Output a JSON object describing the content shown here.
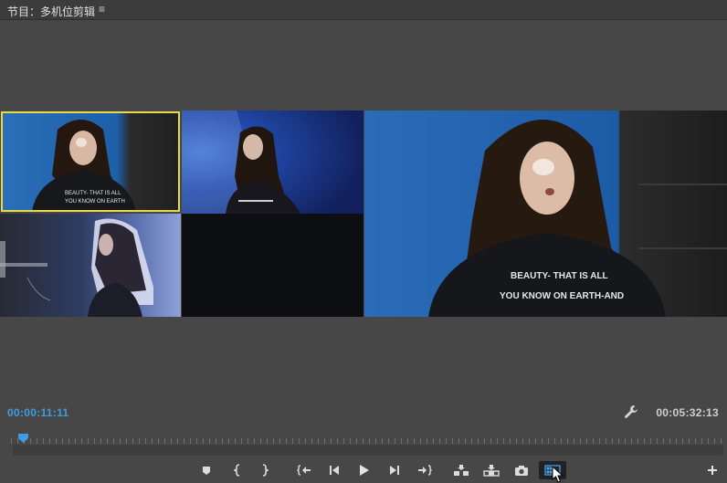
{
  "panel": {
    "title": "节目：多机位剪辑",
    "menu_glyph": "≡"
  },
  "multicam": {
    "cameras": [
      {
        "name": "camera-1",
        "active": true,
        "shirt_text": [
          "BEAUTY- THAT IS ALL",
          "YOU KNOW ON EARTH"
        ]
      },
      {
        "name": "camera-2",
        "active": false
      },
      {
        "name": "camera-3",
        "active": false
      },
      {
        "name": "camera-4",
        "active": false
      }
    ],
    "program_shirt_text": [
      "BEAUTY- THAT IS ALL",
      "YOU KNOW ON EARTH-AND"
    ],
    "active_outline_color": "#e8d84a"
  },
  "timecode": {
    "current": "00:00:11:11",
    "duration": "00:05:32:13",
    "current_color": "#3d9de0"
  },
  "transport": {
    "buttons": [
      "add-marker-icon",
      "mark-in-icon",
      "mark-out-icon",
      "go-to-in-icon",
      "step-back-icon",
      "play-icon",
      "step-forward-icon",
      "go-to-out-icon",
      "insert-icon",
      "overwrite-icon",
      "export-frame-icon",
      "multicam-view-icon",
      "add-button-icon"
    ]
  }
}
